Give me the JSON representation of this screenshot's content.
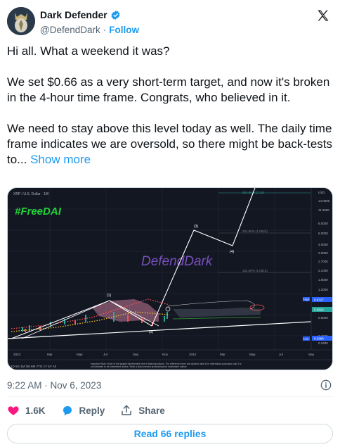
{
  "author": {
    "display_name": "Dark Defender",
    "handle": "@DefendDark",
    "separator": "·",
    "follow_label": "Follow",
    "verified": true
  },
  "tweet": {
    "paragraph_1": "Hi all. What a weekend it was?",
    "paragraph_2": "We set $0.66 as a very short-term target, and now it's broken in the 4-hour time frame. Congrats, who believed in it.",
    "paragraph_3": "We need to stay above this level today as well. The daily time frame indicates we are oversold, so there might be back-tests to...",
    "show_more_label": "Show more"
  },
  "chart": {
    "header": "XRP / U.S. Dollar · 1W",
    "hashtag": "#FreeDAI",
    "watermark": "DefendDark",
    "wave_labels": [
      "(1)",
      "(2)",
      "(3)",
      "(4)"
    ],
    "fib_labels": [
      "261.80% (2.13)",
      "261.80% (1.0543)",
      "161.80% (1.0815)"
    ],
    "price_scale": [
      "USD",
      "14.0000",
      "11.0000",
      "8.0000",
      "6.0000",
      "4.0000",
      "3.5000",
      "2.7000",
      "2.1000",
      "1.6000",
      "1.2000",
      "0.9317",
      "0.6824",
      "0.5000",
      "0.3300",
      "0.2996",
      "0.2400"
    ],
    "price_tags": {
      "high": "High",
      "low": "Low"
    },
    "time_axis": [
      "2023",
      "Mar",
      "May",
      "Jul",
      "Sep",
      "Nov",
      "2024",
      "Mar",
      "May",
      "Jul",
      "Sep"
    ],
    "timeframes": "1D  5D  1M  3M  6M  YTD  1Y  5Y  All",
    "disclaimer": "Important Note: None of the targets represented here is financial advice. The references here are opinions and is for information purposes only. It is not intended to be investment advice. Seek a duly licensed professional for investment advice."
  },
  "meta": {
    "timestamp": "9:22 AM · Nov 6, 2023"
  },
  "actions": {
    "likes": "1.6K",
    "reply_label": "Reply",
    "share_label": "Share"
  },
  "read_replies_label": "Read 66 replies",
  "colors": {
    "accent": "#1d9bf0",
    "like": "#f91880",
    "text_primary": "#0f1419",
    "text_secondary": "#536471",
    "chart_bg": "#131722"
  }
}
